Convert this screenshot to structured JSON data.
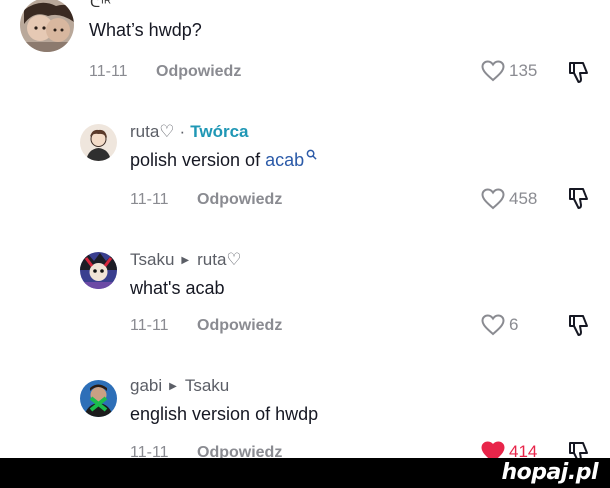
{
  "top_comment": {
    "header_partial": "ᕦᴵᴿ",
    "text": "What’s hwdp?",
    "date": "11-11",
    "reply_label": "Odpowiedz",
    "likes": "135",
    "liked": false
  },
  "replies": [
    {
      "author": "ruta♡",
      "separator": "·",
      "badge": "Twórca",
      "text_prefix": "polish version of ",
      "text_tag": "acab",
      "date": "11-11",
      "reply_label": "Odpowiedz",
      "likes": "458",
      "liked": false
    },
    {
      "author": "Tsaku",
      "reply_to": "ruta♡",
      "text": "what's acab",
      "date": "11-11",
      "reply_label": "Odpowiedz",
      "likes": "6",
      "liked": false
    },
    {
      "author": "gabi",
      "reply_to": "Tsaku",
      "text": "english version of hwdp",
      "date": "11-11",
      "reply_label": "Odpowiedz",
      "likes": "414",
      "liked": true
    }
  ],
  "footer": {
    "watermark": "hopaj.pl"
  },
  "colors": {
    "creator_badge": "#1f97b5",
    "hashtag_link": "#2b5aa8",
    "liked_heart": "#e8254a",
    "muted_text": "#8a8b91"
  },
  "icons": [
    "heart-icon",
    "dislike-icon",
    "search-icon",
    "reply-arrow-icon"
  ]
}
